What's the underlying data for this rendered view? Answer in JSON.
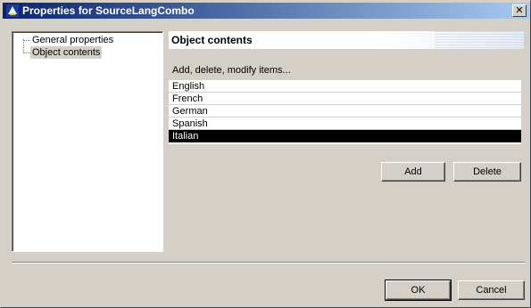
{
  "window": {
    "title": "Properties for SourceLangCombo",
    "close_label": "✕"
  },
  "tree": {
    "items": [
      {
        "label": "General properties",
        "selected": false
      },
      {
        "label": "Object contents",
        "selected": true
      }
    ]
  },
  "panel": {
    "header": "Object contents",
    "instructions": "Add, delete, modify items...",
    "list": [
      "English",
      "French",
      "German",
      "Spanish",
      "Italian"
    ],
    "selected_item": "Italian"
  },
  "buttons": {
    "add": "Add",
    "delete": "Delete",
    "ok": "OK",
    "cancel": "Cancel"
  },
  "colors": {
    "title_start": "#0a246a",
    "title_end": "#a6caf0",
    "face": "#d4d0c8",
    "selection": "#000000"
  }
}
